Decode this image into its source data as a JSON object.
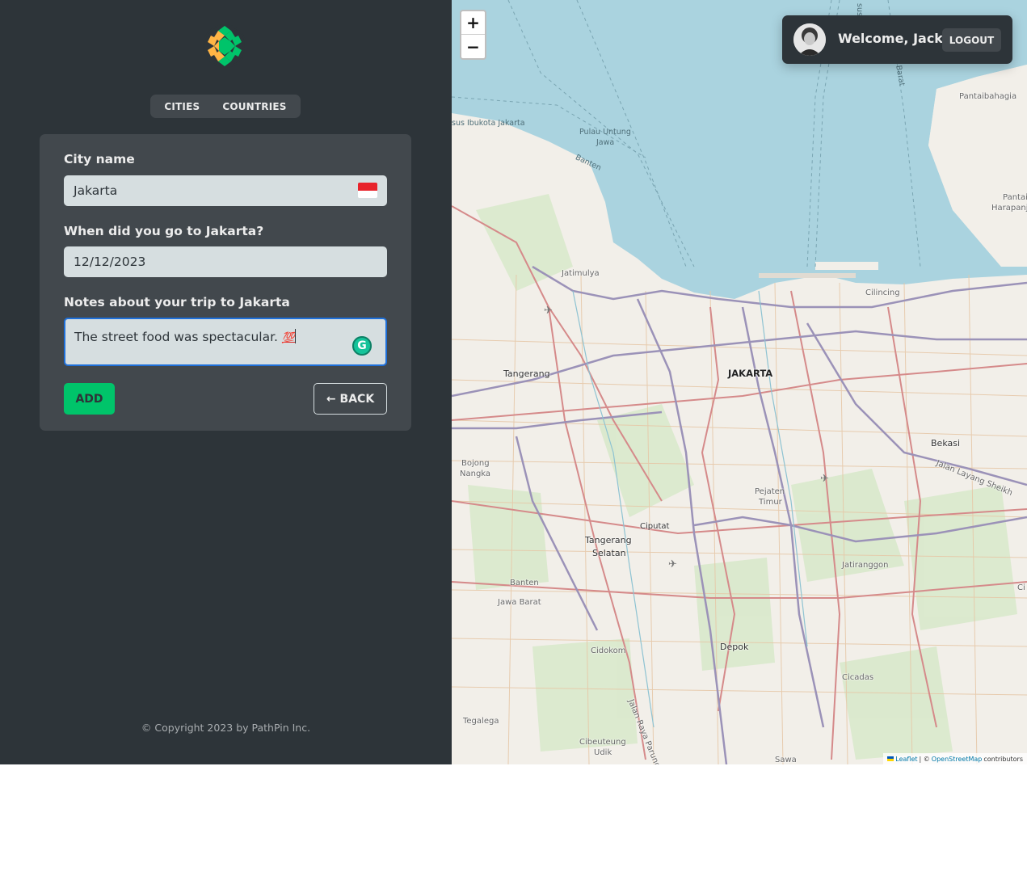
{
  "nav": {
    "cities_label": "CITIES",
    "countries_label": "COUNTRIES"
  },
  "form": {
    "city_label": "City name",
    "city_value": "Jakarta",
    "date_label": "When did you go to Jakarta?",
    "date_value": "12/12/2023",
    "notes_label": "Notes about your trip to Jakarta",
    "notes_value": "The street food was spectacular. ",
    "notes_emoji": "💯",
    "add_label": "ADD",
    "back_label": "BACK",
    "back_arrow": "←"
  },
  "footer": {
    "copyright": "© Copyright 2023 by PathPin Inc."
  },
  "map": {
    "zoom_in": "+",
    "zoom_out": "−",
    "places": {
      "jakarta": "JAKARTA",
      "tangerang": "Tangerang",
      "bekasi": "Bekasi",
      "depok": "Depok",
      "ciputat": "Ciputat",
      "tangerang_selatan_1": "Tangerang",
      "tangerang_selatan_2": "Selatan",
      "jatimulya": "Jatimulya",
      "cilincing": "Cilincing",
      "pantaibahagia": "Pantaibahagia",
      "pantai_harapan_1": "Pantai",
      "pantai_harapan_2": "Harapanj",
      "pulau_untung_1": "Pulau Untung",
      "pulau_untung_2": "Jawa",
      "banten_water": "Banten",
      "ibukota": "sus Ibukota Jakarta",
      "bojong_1": "Bojong",
      "bojong_2": "Nangka",
      "pejaten_1": "Pejaten",
      "pejaten_2": "Timur",
      "jatiranggon": "Jatiranggon",
      "banten": "Banten",
      "jawa_barat": "Jawa Barat",
      "cidokom": "Cidokom",
      "cicadas": "Cicadas",
      "tegalega": "Tegalega",
      "cibeuteung_1": "Cibeuteung",
      "cibeuteung_2": "Udik",
      "jalan_raya_parung": "Jalan Raya Parung",
      "jalan_layang": "Jalan Layang Sheikh",
      "barat": "Barat",
      "sus": "sus",
      "sawa": "Sawa",
      "ci": "Ci"
    },
    "attribution": {
      "leaflet": "Leaflet",
      "separator": "| ©",
      "osm": "OpenStreetMap",
      "contributors": "contributors"
    }
  },
  "user": {
    "welcome": "Welcome, Jack",
    "logout_label": "LOGOUT"
  },
  "colors": {
    "sidebar_bg": "#2d3439",
    "card_bg": "#42484d",
    "accent_green": "#00c46a",
    "input_bg": "#d6dee0",
    "water": "#aad3df"
  }
}
